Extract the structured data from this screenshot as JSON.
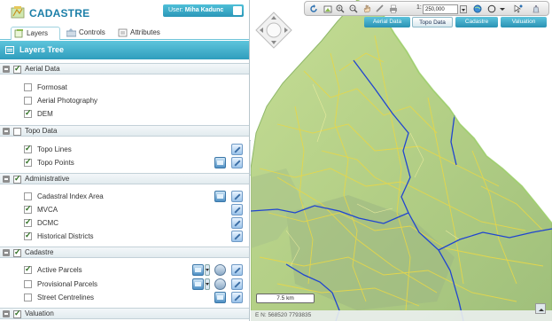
{
  "app": {
    "title": "CADASTRE",
    "user_label": "User:",
    "user_name": "Miha Kadunc"
  },
  "tabs": [
    {
      "label": "Layers",
      "icon": "layers-icon"
    },
    {
      "label": "Controls",
      "icon": "controls-icon"
    },
    {
      "label": "Attributes",
      "icon": "attributes-icon"
    }
  ],
  "tree_title": "Layers Tree",
  "groups": [
    {
      "label": "Aerial Data",
      "checked": true,
      "layers": [
        {
          "label": "Formosat",
          "checked": false
        },
        {
          "label": "Aerial Photography",
          "checked": false
        },
        {
          "label": "DEM",
          "checked": true
        }
      ]
    },
    {
      "label": "Topo Data",
      "checked": false,
      "layers": [
        {
          "label": "Topo Lines",
          "checked": true
        },
        {
          "label": "Topo Points",
          "checked": true
        }
      ]
    },
    {
      "label": "Administrative",
      "checked": true,
      "layers": [
        {
          "label": "Cadastral Index Area",
          "checked": false
        },
        {
          "label": "MVCA",
          "checked": true
        },
        {
          "label": "DCMC",
          "checked": true
        },
        {
          "label": "Historical Districts",
          "checked": true
        }
      ]
    },
    {
      "label": "Cadastre",
      "checked": true,
      "layers": [
        {
          "label": "Active Parcels",
          "checked": true
        },
        {
          "label": "Provisional Parcels",
          "checked": false
        },
        {
          "label": "Street Centrelines",
          "checked": false
        }
      ]
    },
    {
      "label": "Valuation",
      "checked": true,
      "layers": []
    }
  ],
  "map": {
    "scale_prefix": "1:",
    "scale_value": "250,000",
    "tabs": [
      {
        "label": "Aerial Data",
        "active": false
      },
      {
        "label": "Topo Data",
        "active": true
      },
      {
        "label": "Cadastre",
        "active": false
      },
      {
        "label": "Valuation",
        "active": false
      }
    ],
    "scale_bar": "7.5 km",
    "coordinates": "E N: 568520 7793835"
  },
  "colors": {
    "accent": "#2f9dbd",
    "title": "#1c7fa8",
    "land": "#b9d48e",
    "roads": "#e8d64a",
    "boundaries": "#2045d0"
  }
}
